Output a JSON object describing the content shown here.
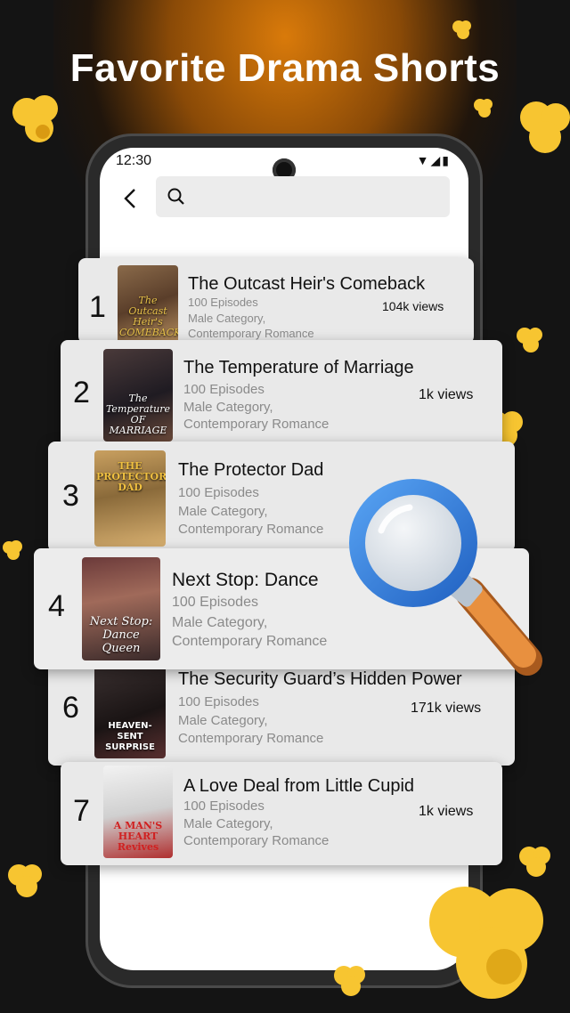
{
  "headline": "Favorite Drama Shorts",
  "status_bar": {
    "time": "12:30",
    "icons": "▼◢▮"
  },
  "search": {
    "placeholder": ""
  },
  "items": [
    {
      "rank": "1",
      "title": "The Outcast Heir's Comeback",
      "episodes": "100 Episodes",
      "category": "Male Category,",
      "genre": "Contemporary Romance",
      "views": "104k views",
      "poster_text": "The Outcast Heir's COMEBACK"
    },
    {
      "rank": "2",
      "title": "The Temperature of Marriage",
      "episodes": "100 Episodes",
      "category": "Male Category,",
      "genre": "Contemporary Romance",
      "views": "1k views",
      "poster_text": "The Temperature OF MARRIAGE"
    },
    {
      "rank": "3",
      "title": "The Protector Dad",
      "episodes": "100 Episodes",
      "category": "Male Category,",
      "genre": "Contemporary Romance",
      "views": "",
      "poster_text": "THE PROTECTOR DAD"
    },
    {
      "rank": "4",
      "title": "Next Stop: Dance",
      "episodes": "100 Episodes",
      "category": "Male Category,",
      "genre": "Contemporary Romance",
      "views": "",
      "poster_text": "Next Stop: Dance Queen"
    },
    {
      "rank": "6",
      "title": "The Security Guard’s Hidden Power",
      "episodes": "100 Episodes",
      "category": "Male Category,",
      "genre": "Contemporary Romance",
      "views": "171k views",
      "poster_text": "HEAVEN-SENT SURPRISE"
    },
    {
      "rank": "7",
      "title": "A Love Deal from Little Cupid",
      "episodes": "100 Episodes",
      "category": "Male Category,",
      "genre": "Contemporary Romance",
      "views": "1k views",
      "poster_text": "A MAN'S HEART Revives"
    }
  ],
  "colors": {
    "background": "#141414",
    "glow": "#d97a0a",
    "card": "#e9e9e9",
    "popcorn": "#f7c531",
    "magnifier": "#2f7fe0",
    "handle": "#e0893a"
  }
}
